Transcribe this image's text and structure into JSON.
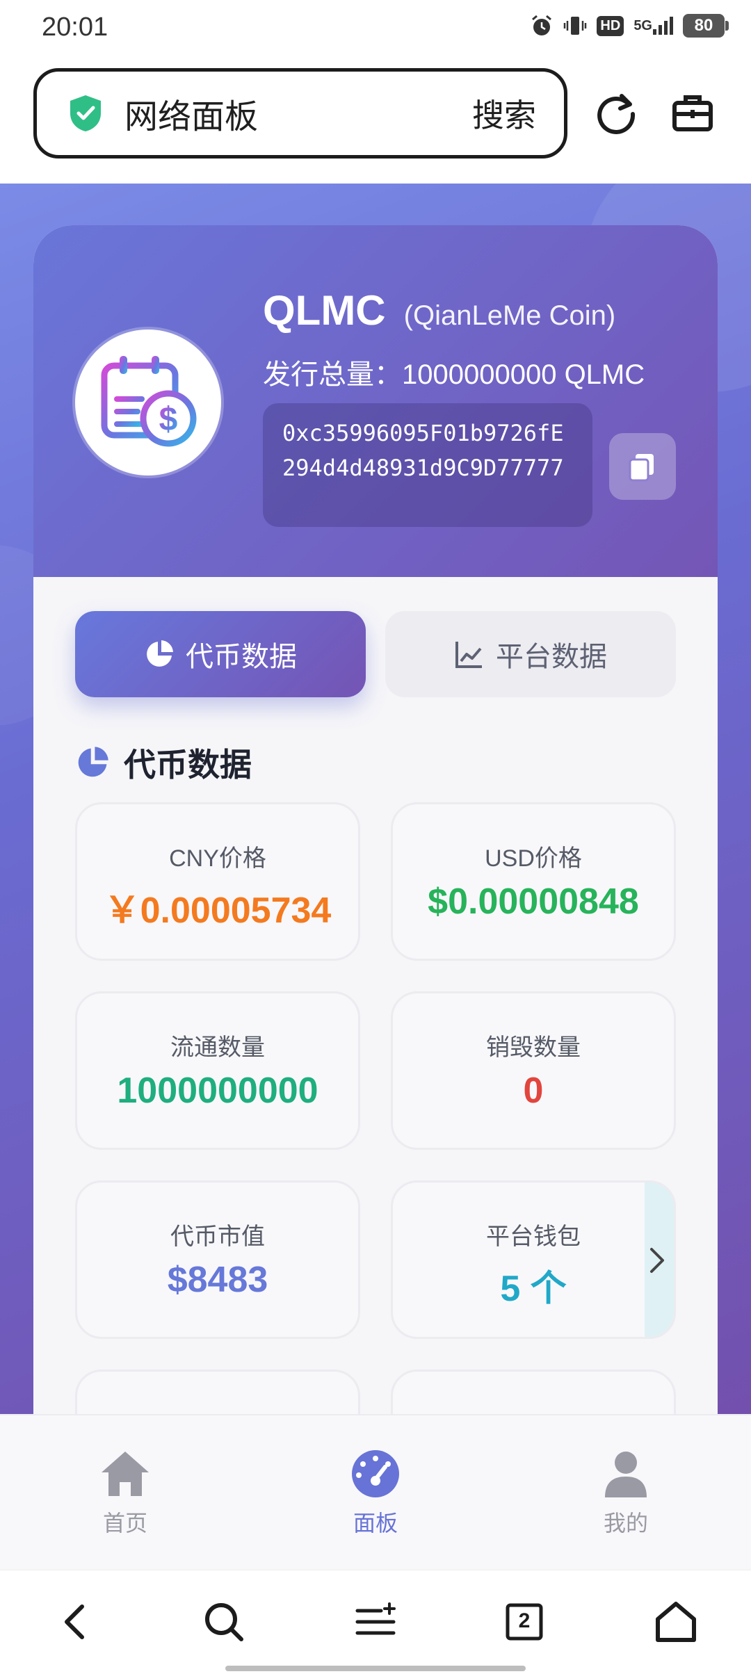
{
  "status_bar": {
    "time": "20:01",
    "hd": "HD",
    "network": "5G",
    "battery": "80"
  },
  "address_bar": {
    "title": "网络面板",
    "search_label": "搜索"
  },
  "token": {
    "symbol": "QLMC",
    "full_name": "(QianLeMe Coin)",
    "supply": "发行总量：1000000000 QLMC",
    "address": "0xc35996095F01b9726fE294d4d48931d9C9D77777"
  },
  "tabs": [
    {
      "label": "代币数据",
      "active": true
    },
    {
      "label": "平台数据",
      "active": false
    }
  ],
  "section_title": "代币数据",
  "stats": [
    {
      "label": "CNY价格",
      "value": "￥0.00005734",
      "color": "#f47a1f"
    },
    {
      "label": "USD价格",
      "value": "$0.00000848",
      "color": "#27b35a"
    },
    {
      "label": "流通数量",
      "value": "1000000000",
      "color": "#1fae7e"
    },
    {
      "label": "销毁数量",
      "value": "0",
      "color": "#e2453d"
    },
    {
      "label": "代币市值",
      "value": "$8483",
      "color": "#6678d8"
    },
    {
      "label": "平台钱包",
      "value": "5 个",
      "color": "#21a8c8"
    }
  ],
  "bottom_nav": [
    {
      "label": "首页",
      "icon": "home-icon",
      "active": false
    },
    {
      "label": "面板",
      "icon": "dashboard-icon",
      "active": true
    },
    {
      "label": "我的",
      "icon": "user-icon",
      "active": false
    }
  ],
  "browser_toolbar": {
    "tab_count": "2"
  },
  "colors": {
    "accent": "#6773d6",
    "gradient_start": "#6a76d9",
    "gradient_end": "#7456b6"
  }
}
